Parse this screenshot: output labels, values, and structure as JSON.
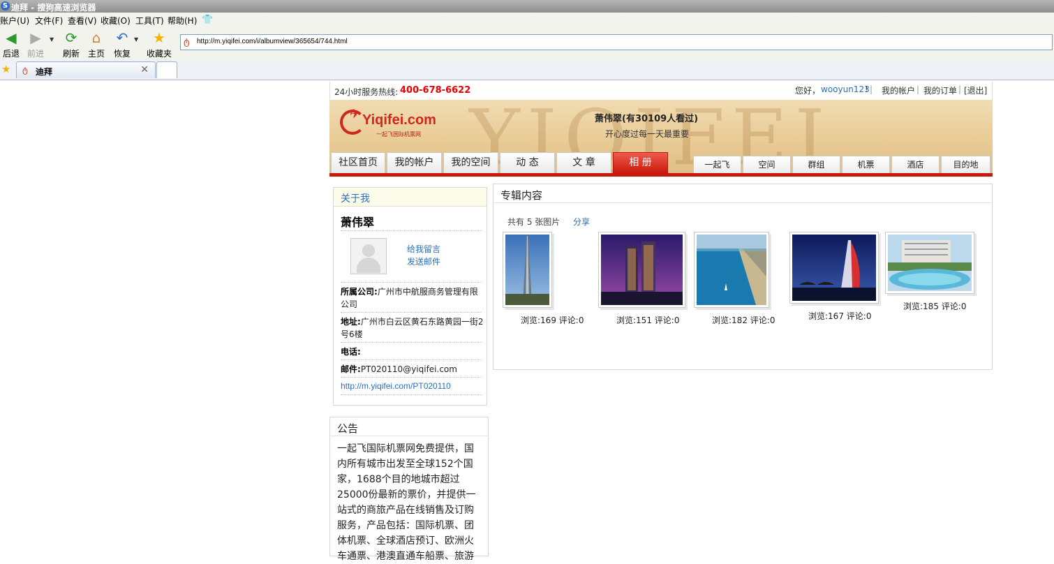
{
  "window": {
    "title": "迪拜 - 搜狗高速浏览器"
  },
  "menu": [
    "账户(U)",
    "文件(F)",
    "查看(V)",
    "收藏(O)",
    "工具(T)",
    "帮助(H)"
  ],
  "toolbar": {
    "back": "后退",
    "forward": "前进",
    "refresh": "刷新",
    "home": "主页",
    "restore": "恢复",
    "favorites": "收藏夹"
  },
  "address": {
    "url": "http://m.yiqifei.com/i/albumview/365654/744.html"
  },
  "tabs": [
    {
      "label": "迪拜"
    }
  ],
  "topbar": {
    "hotline_label": "24小时服务热线:",
    "hotline": "400-678-6622",
    "greeting": "您好，",
    "username": "wooyun123",
    "bang": "!",
    "my_account": "我的帐户",
    "my_orders": "我的订单",
    "logout": "[退出]"
  },
  "header": {
    "brand": "Yiqifei.com",
    "brand_sub": "一起飞国际机票网",
    "page_title": "萧伟翠(有30109人看过)",
    "motto": "开心度过每一天最重要"
  },
  "nav_left": [
    "社区首页",
    "我的帐户",
    "我的空间",
    "动 态",
    "文 章",
    "相 册"
  ],
  "nav_right": [
    "一起飞",
    "空间",
    "群组",
    "机票",
    "酒店",
    "目的地"
  ],
  "about": {
    "title": "关于我",
    "name": "萧伟翠",
    "leave_message": "给我留言",
    "send_mail": "发送邮件",
    "company_label": "所属公司:",
    "company": "广州市中航服商务管理有限公司",
    "address_label": "地址:",
    "address": "广州市白云区黄石东路黄园一街2号6楼",
    "phone_label": "电话:",
    "email_label": "邮件:",
    "email": "PT020110@yiqifei.com",
    "homepage": "http://m.yiqifei.com/PT020110"
  },
  "notice": {
    "title": "公告",
    "text": "一起飞国际机票网免费提供，国内所有城市出发至全球152个国家，1688个目的地城市超过25000份最新的票价，并提供一站式的商旅产品在线销售及订购服务，产品包括：国际机票、团体机票、全球酒店预订、欧洲火车通票、港澳直通车船票、旅游"
  },
  "album": {
    "title": "专辑内容",
    "count_text": "共有 5 张图片",
    "share": "分享",
    "photos": [
      {
        "views": "浏览:169",
        "comments": "评论:0"
      },
      {
        "views": "浏览:151",
        "comments": "评论:0"
      },
      {
        "views": "浏览:182",
        "comments": "评论:0"
      },
      {
        "views": "浏览:167",
        "comments": "评论:0"
      },
      {
        "views": "浏览:185",
        "comments": "评论:0"
      }
    ]
  },
  "colors": {
    "accent_red": "#c8190c",
    "link_blue": "#2a6fb5",
    "hotline_red": "#e00000"
  }
}
